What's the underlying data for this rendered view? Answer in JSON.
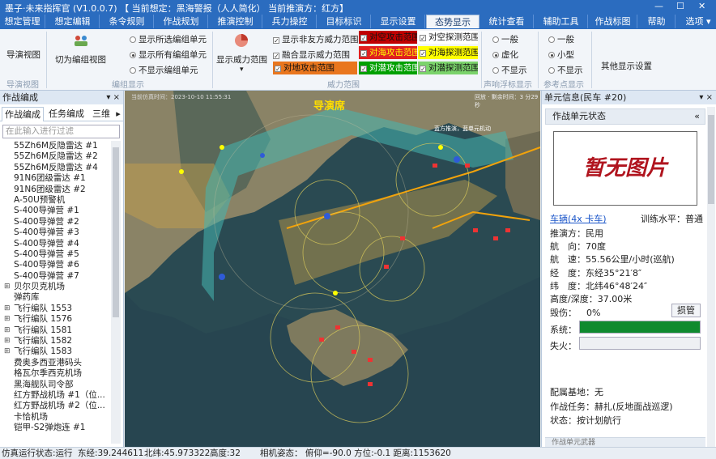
{
  "window": {
    "title": "墨子·未来指挥官 (V1.0.0.7) 【 当前想定：黑海警报（人人简化） 当前推演方：红方】",
    "minimize": "—",
    "maximize": "☐",
    "close": "✕"
  },
  "menu": {
    "items": [
      "想定管理",
      "想定编辑",
      "条令规则",
      "作战规划",
      "推演控制",
      "兵力操控",
      "目标标识",
      "显示设置",
      "态势显示",
      "统计查看",
      "辅助工具",
      "作战标图",
      "帮助"
    ],
    "active": "态势显示",
    "options": "选项",
    "options_arrow": "▾"
  },
  "ribbon": {
    "nav_view_btn": "导演视图",
    "nav_view_group": "导演视图",
    "switch_group_btn": "切为编组视图",
    "group_display_label": "编组显示",
    "group_radios": [
      "显示所选编组单元",
      "显示所有编组单元",
      "不显示编组单元"
    ],
    "group_radio_selected": 1,
    "show_threat_btn": "显示威力范围",
    "threat_checks": [
      "显示非友方威力范围",
      "融合显示威力范围"
    ],
    "threat_group_label": "威力范围",
    "ground_attack": "对地攻击范围",
    "range_cells": [
      {
        "label": "对空攻击范围",
        "bg": "#c00000",
        "fg": "#111111"
      },
      {
        "label": "对空探测范围",
        "bg": "#ffffff",
        "fg": "#111111"
      },
      {
        "label": "对海攻击范围",
        "bg": "#e02020",
        "fg": "#ffff00"
      },
      {
        "label": "对海探测范围",
        "bg": "#ffff00",
        "fg": "#111111"
      },
      {
        "label": "对潜攻击范围",
        "bg": "#00a000",
        "fg": "#ffffff"
      },
      {
        "label": "对潜探测范围",
        "bg": "#7bd36b",
        "fg": "#111111"
      }
    ],
    "marker_radios": [
      "一般",
      "虚化",
      "不显示"
    ],
    "marker_selected": 1,
    "marker_group_label": "声响浮标显示",
    "ref_radios": [
      "一般",
      "小型",
      "不显示"
    ],
    "ref_selected": 1,
    "ref_group_label": "参考点显示",
    "other_settings": "其他显示设置"
  },
  "left_panel": {
    "title": "作战编成",
    "pin": "▾ ×",
    "tabs": [
      "作战编成",
      "任务编成",
      "三维"
    ],
    "tab_arrow": "▸",
    "filter_placeholder": "在此输入进行过滤",
    "tree": [
      {
        "label": "55Zh6M反隐雷达 #1",
        "expand": ""
      },
      {
        "label": "55Zh6M反隐雷达 #2",
        "expand": ""
      },
      {
        "label": "55Zh6M反隐雷达 #4",
        "expand": ""
      },
      {
        "label": "91N6团级雷达 #1",
        "expand": ""
      },
      {
        "label": "91N6团级雷达 #2",
        "expand": ""
      },
      {
        "label": "A-50U预警机",
        "expand": ""
      },
      {
        "label": "S-400导弹营 #1",
        "expand": ""
      },
      {
        "label": "S-400导弹营 #2",
        "expand": ""
      },
      {
        "label": "S-400导弹营 #3",
        "expand": ""
      },
      {
        "label": "S-400导弹营 #4",
        "expand": ""
      },
      {
        "label": "S-400导弹营 #5",
        "expand": ""
      },
      {
        "label": "S-400导弹营 #6",
        "expand": ""
      },
      {
        "label": "S-400导弹营 #7",
        "expand": ""
      },
      {
        "label": "贝尔贝克机场",
        "expand": "⊞"
      },
      {
        "label": "弹药库",
        "expand": ""
      },
      {
        "label": "飞行编队 1553",
        "expand": "⊞"
      },
      {
        "label": "飞行编队 1576",
        "expand": "⊞"
      },
      {
        "label": "飞行编队 1581",
        "expand": "⊞"
      },
      {
        "label": "飞行编队 1582",
        "expand": "⊞"
      },
      {
        "label": "飞行编队 1583",
        "expand": "⊞"
      },
      {
        "label": "费奥多西亚港码头",
        "expand": ""
      },
      {
        "label": "格瓦尔季西克机场",
        "expand": ""
      },
      {
        "label": "黑海舰队司令部",
        "expand": ""
      },
      {
        "label": "红方野战机场 #1（位...",
        "expand": ""
      },
      {
        "label": "红方野战机场 #2（位...",
        "expand": ""
      },
      {
        "label": "卡恰机场",
        "expand": ""
      },
      {
        "label": "铠甲-S2弹炮连 #1",
        "expand": ""
      }
    ]
  },
  "map": {
    "top_info": "当前仿真时间：2023-10-10 11:55:31",
    "director_label": "导演席",
    "top_right": "回放 · 剩余时间：3 分29秒",
    "note_label": "蓝方推演，蓝单元机动"
  },
  "right_panel": {
    "title": "单元信息(民车 #20)",
    "pin": "▾ ×",
    "section": "作战单元状态",
    "collapse": "«",
    "no_image": "暂无图片",
    "vehicle_link": "车辆(4x 卡车)",
    "training_label": "训练水平：",
    "training_value": "普通",
    "fields": [
      {
        "label": "推演方：",
        "value": "民用"
      },
      {
        "label": "航　向：",
        "value": "70度"
      },
      {
        "label": "航　速：",
        "value": "55.56公里/小时(巡航)"
      },
      {
        "label": "经　度：",
        "value": "东经35°21′8″"
      },
      {
        "label": "纬　度：",
        "value": "北纬46°48′24″"
      },
      {
        "label": "高度/深度：",
        "value": "37.00米"
      }
    ],
    "damage_label": "毁伤：",
    "damage_value": "0%",
    "damage_btn": "损管",
    "system_label": "系统：",
    "system_level": 1.0,
    "failure_label": "失火：",
    "base_label": "配属基地：",
    "base_value": "无",
    "task_label": "作战任务：",
    "task_value": "赫扎(反地面战巡逻)",
    "state_label": "状态：",
    "state_value": "按计划航行",
    "bottom_section": "作战单元武器"
  },
  "status_bar": {
    "sim_state": "仿真运行状态:运行",
    "longitude": "东经:39.244611",
    "latitude": "北纬:45.973322",
    "altitude": "高度:32",
    "attitude": "相机姿态： 俯仰=-90.0  方位:-0.1  距离:1153620"
  },
  "colors": {
    "title_bar": "#2b6cbf",
    "ribbon": "#f2f5f9",
    "sea": "#2a4a52",
    "land": "#8a8366",
    "system_bar": "#0f8a2e"
  }
}
